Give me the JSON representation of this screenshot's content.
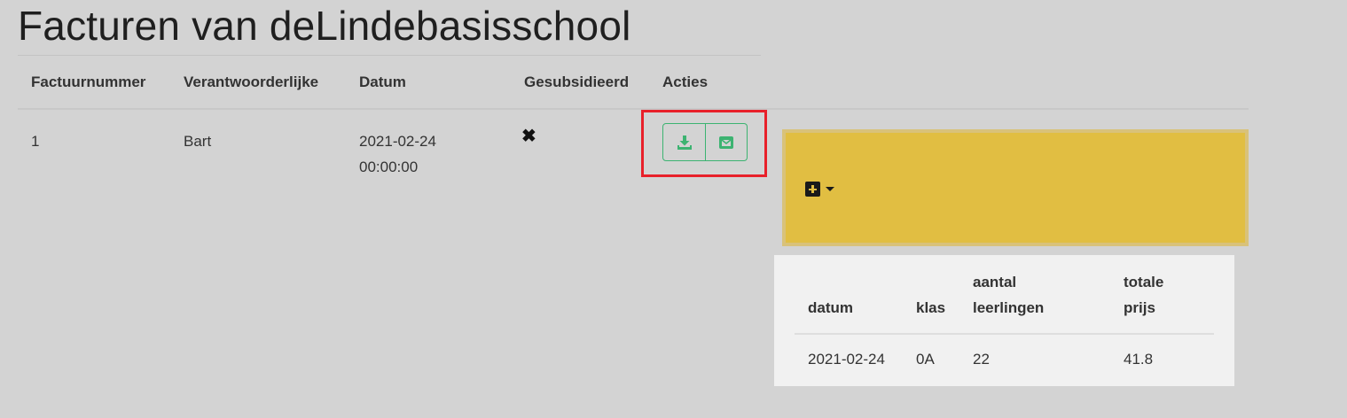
{
  "page": {
    "title": "Facturen van deLindebasisschool"
  },
  "table": {
    "headers": {
      "invoice_number": "Factuurnummer",
      "responsible": "Verantwoorderlijke",
      "date": "Datum",
      "subsidized": "Gesubsidieerd",
      "actions": "Acties"
    },
    "rows": [
      {
        "invoice_number": "1",
        "responsible": "Bart",
        "date": "2021-02-24 00:00:00",
        "subsidized": "✖"
      }
    ]
  },
  "actions": {
    "download_icon": "download-icon",
    "email_icon": "envelope-icon"
  },
  "panel": {
    "add_icon": "plus-square-icon",
    "caret_icon": "caret-down-icon"
  },
  "detail_table": {
    "headers": {
      "date": "datum",
      "class": "klas",
      "students_line1": "aantal",
      "students_line2": "leerlingen",
      "total_line1": "totale",
      "total_line2": "prijs"
    },
    "rows": [
      {
        "date": "2021-02-24",
        "class": "0A",
        "students": "22",
        "total": "41.8"
      }
    ]
  },
  "colors": {
    "background": "#d3d3d3",
    "action_green": "#3cb371",
    "highlight_red": "#e8202a",
    "panel_yellow": "#e1be42",
    "detail_bg": "#f1f1f1"
  }
}
